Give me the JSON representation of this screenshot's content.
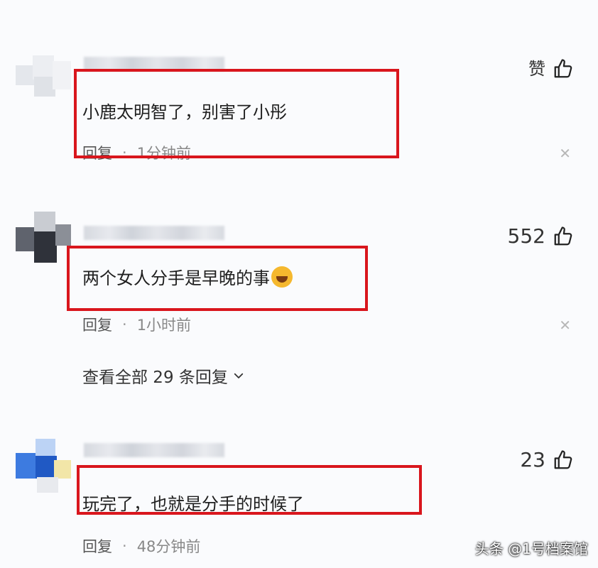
{
  "comments": [
    {
      "like_label": "赞",
      "text": "小鹿太明智了，别害了小彤",
      "reply_label": "回复",
      "separator": "·",
      "time": "1分钟前"
    },
    {
      "like_label": "552",
      "text": "两个女人分手是早晚的事",
      "emoji": "face-with-tears-of-joy-emoji",
      "reply_label": "回复",
      "separator": "·",
      "time": "1小时前",
      "view_all": "查看全部 29 条回复"
    },
    {
      "like_label": "23",
      "text": "玩完了，也就是分手的时候了",
      "reply_label": "回复",
      "separator": "·",
      "time": "48分钟前"
    }
  ],
  "icons": {
    "like": "thumbs-up-icon",
    "close": "close-icon",
    "expand": "chevron-down-icon"
  },
  "colors": {
    "highlight": "#d9161d",
    "background": "#fafbfd"
  },
  "watermark": "头条 @1号档案馆"
}
